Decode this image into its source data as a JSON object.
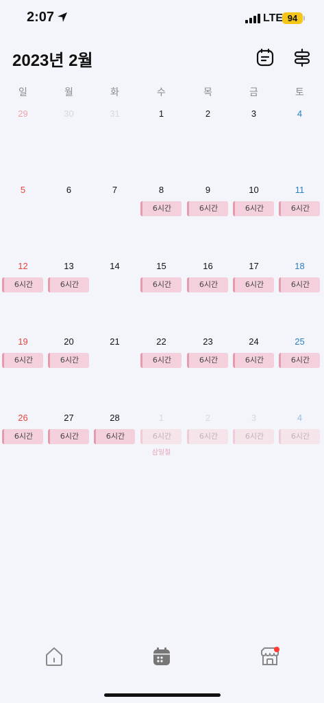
{
  "status": {
    "time": "2:07",
    "network": "LTE",
    "battery": "94"
  },
  "header": {
    "title": "2023년 2월"
  },
  "weekdays": [
    "일",
    "월",
    "화",
    "수",
    "목",
    "금",
    "토"
  ],
  "colors": {
    "sunday": "#e8423c",
    "saturday": "#2a7fc0",
    "chip": "#f3d0db",
    "chip_accent": "#e59aae",
    "other_month": "#b5b5b5"
  },
  "weeks": [
    [
      {
        "day": "29",
        "other": true
      },
      {
        "day": "30",
        "other": true
      },
      {
        "day": "31",
        "other": true
      },
      {
        "day": "1"
      },
      {
        "day": "2"
      },
      {
        "day": "3"
      },
      {
        "day": "4"
      }
    ],
    [
      {
        "day": "5"
      },
      {
        "day": "6"
      },
      {
        "day": "7"
      },
      {
        "day": "8",
        "chip": "6시간"
      },
      {
        "day": "9",
        "chip": "6시간"
      },
      {
        "day": "10",
        "chip": "6시간"
      },
      {
        "day": "11",
        "chip": "6시간"
      }
    ],
    [
      {
        "day": "12",
        "chip": "6시간"
      },
      {
        "day": "13",
        "chip": "6시간"
      },
      {
        "day": "14"
      },
      {
        "day": "15",
        "chip": "6시간"
      },
      {
        "day": "16",
        "chip": "6시간"
      },
      {
        "day": "17",
        "chip": "6시간"
      },
      {
        "day": "18",
        "chip": "6시간"
      }
    ],
    [
      {
        "day": "19",
        "chip": "6시간"
      },
      {
        "day": "20",
        "chip": "6시간"
      },
      {
        "day": "21"
      },
      {
        "day": "22",
        "chip": "6시간"
      },
      {
        "day": "23",
        "chip": "6시간"
      },
      {
        "day": "24",
        "chip": "6시간"
      },
      {
        "day": "25",
        "chip": "6시간"
      }
    ],
    [
      {
        "day": "26",
        "chip": "6시간"
      },
      {
        "day": "27",
        "chip": "6시간"
      },
      {
        "day": "28",
        "chip": "6시간"
      },
      {
        "day": "1",
        "other": true,
        "chip": "6시간",
        "holiday": "삼일절"
      },
      {
        "day": "2",
        "other": true,
        "chip": "6시간"
      },
      {
        "day": "3",
        "other": true,
        "chip": "6시간"
      },
      {
        "day": "4",
        "other": true,
        "chip": "6시간"
      }
    ]
  ],
  "tabs": [
    {
      "name": "home",
      "icon": "home-icon"
    },
    {
      "name": "calendar",
      "icon": "calendar-icon"
    },
    {
      "name": "store",
      "icon": "store-icon"
    }
  ]
}
